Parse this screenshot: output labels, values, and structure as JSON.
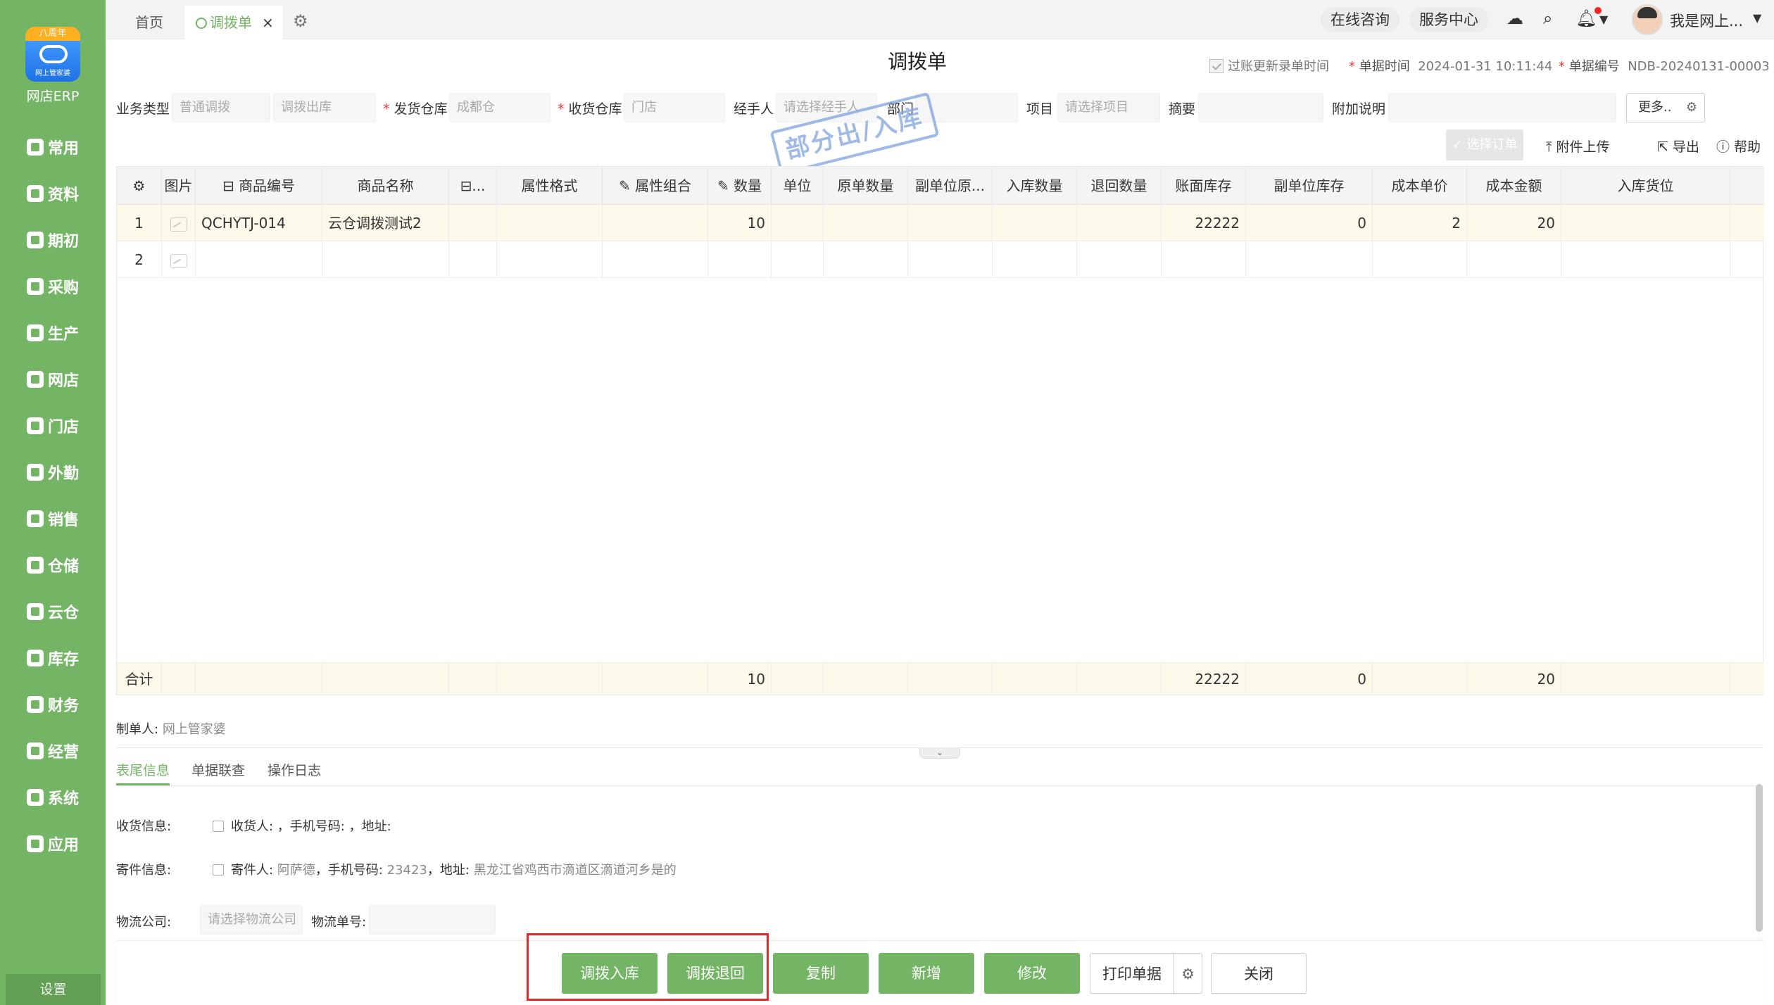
{
  "sidebar": {
    "logo_ribbon": "八周年",
    "logo_sub": "网上管家婆",
    "brand": "网店ERP",
    "items": [
      {
        "label": "常用",
        "icon": "star-icon"
      },
      {
        "label": "资料",
        "icon": "document-icon"
      },
      {
        "label": "期初",
        "icon": "target-icon"
      },
      {
        "label": "采购",
        "icon": "purchase-icon"
      },
      {
        "label": "生产",
        "icon": "production-icon"
      },
      {
        "label": "网店",
        "icon": "shop-icon"
      },
      {
        "label": "门店",
        "icon": "store-icon"
      },
      {
        "label": "外勤",
        "icon": "field-icon"
      },
      {
        "label": "销售",
        "icon": "sales-icon"
      },
      {
        "label": "仓储",
        "icon": "warehouse-icon"
      },
      {
        "label": "云仓",
        "icon": "cloud-warehouse-icon"
      },
      {
        "label": "库存",
        "icon": "inventory-icon"
      },
      {
        "label": "财务",
        "icon": "finance-icon"
      },
      {
        "label": "经营",
        "icon": "business-icon"
      },
      {
        "label": "系统",
        "icon": "system-icon"
      },
      {
        "label": "应用",
        "icon": "apps-icon"
      }
    ],
    "settings": "设置"
  },
  "topbar": {
    "home_tab": "首页",
    "active_tab": "调拨单",
    "close": "×",
    "consult": "在线咨询",
    "service": "服务中心",
    "username": "我是网上..."
  },
  "doc": {
    "title": "调拨单",
    "update_time_label": "过账更新录单时间",
    "date_label": "单据时间",
    "date_value": "2024-01-31 10:11:44",
    "no_label": "单据编号",
    "no_value": "NDB-20240131-00003"
  },
  "form": {
    "biz_type_label": "业务类型",
    "biz_type_value": "普通调拨",
    "biz_type_sub": "调拨出库",
    "from_wh_label": "发货仓库",
    "from_wh_value": "成都仓",
    "to_wh_label": "收货仓库",
    "to_wh_value": "门店",
    "handler_label": "经手人",
    "handler_placeholder": "请选择经手人",
    "dept_label": "部门",
    "project_label": "项目",
    "project_placeholder": "请选择项目",
    "summary_label": "摘要",
    "remark_label": "附加说明",
    "more": "更多.."
  },
  "stamp": "部分出/入库",
  "actions": {
    "select_order": "选择订单",
    "attach": "附件上传",
    "export": "导出",
    "help": "帮助"
  },
  "table": {
    "headers": [
      "",
      "图片",
      "商品编号",
      "商品名称",
      "...",
      "属性格式",
      "属性组合",
      "数量",
      "单位",
      "原单数量",
      "副单位原...",
      "入库数量",
      "退回数量",
      "账面库存",
      "副单位库存",
      "成本单价",
      "成本金额",
      "入库货位"
    ],
    "rows": [
      {
        "idx": "1",
        "code": "QCHYTJ-014",
        "name": "云仓调拨测试2",
        "qty": "10",
        "book_stock": "22222",
        "sub_stock": "0",
        "unit_cost": "2",
        "amount": "20"
      },
      {
        "idx": "2",
        "code": "",
        "name": "",
        "qty": "",
        "book_stock": "",
        "sub_stock": "",
        "unit_cost": "",
        "amount": ""
      }
    ],
    "total_label": "合计",
    "total_qty": "10",
    "total_book_stock": "22222",
    "total_sub_stock": "0",
    "total_amount": "20"
  },
  "footer": {
    "maker_label": "制单人:",
    "maker_value": "网上管家婆",
    "tabs": [
      "表尾信息",
      "单据联查",
      "操作日志"
    ],
    "recv_label": "收货信息:",
    "recv_text": "收货人: ，手机号码: ，地址:",
    "send_label": "寄件信息:",
    "send_person_label": "寄件人:",
    "send_person": "阿萨德",
    "send_phone_label": "，手机号码:",
    "send_phone": "23423",
    "send_addr_label": "，地址:",
    "send_addr": "黑龙江省鸡西市滴道区滴道河乡是的",
    "logistics_label": "物流公司:",
    "logistics_placeholder": "请选择物流公司",
    "tracking_label": "物流单号:"
  },
  "buttons": {
    "transfer_in": "调拨入库",
    "transfer_back": "调拨退回",
    "copy": "复制",
    "add": "新增",
    "modify": "修改",
    "print": "打印单据",
    "close": "关闭"
  }
}
